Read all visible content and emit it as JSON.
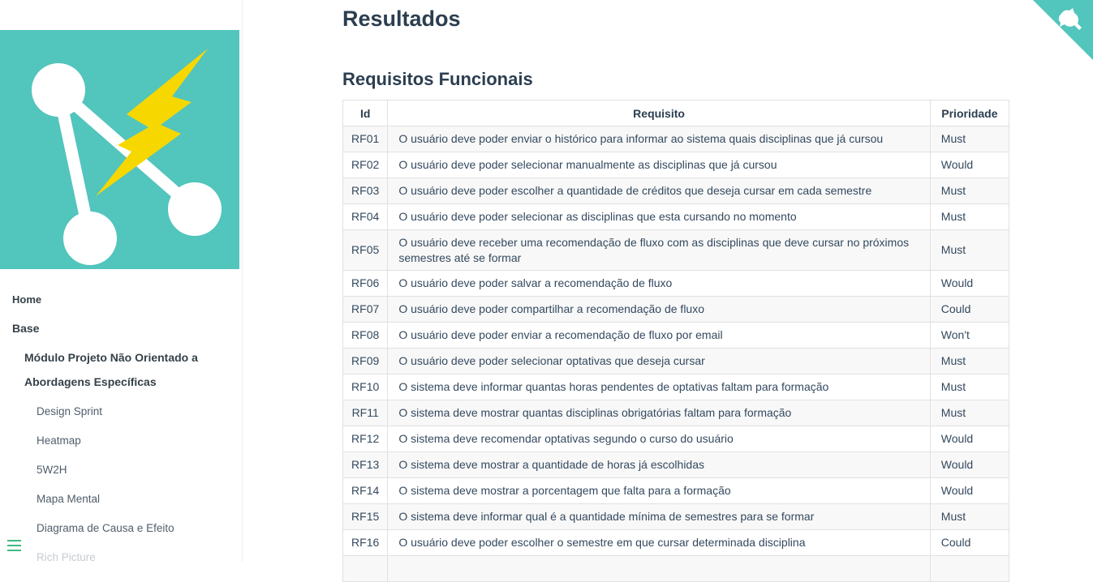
{
  "page": {
    "heading": "Resultados",
    "section_heading": "Requisitos Funcionais"
  },
  "colors": {
    "accent": "#42b983",
    "logo_bg": "#52c5bd",
    "bolt": "#f7d700"
  },
  "sidebar": {
    "items": [
      {
        "label": "Home"
      },
      {
        "label": "Base"
      },
      {
        "label": "Módulo Projeto Não Orientado a"
      },
      {
        "label": "Abordagens Específicas"
      },
      {
        "label": "Design Sprint"
      },
      {
        "label": "Heatmap"
      },
      {
        "label": "5W2H"
      },
      {
        "label": "Mapa Mental"
      },
      {
        "label": "Diagrama de Causa e Efeito"
      },
      {
        "label": "Rich Picture"
      }
    ]
  },
  "icons": {
    "menu": "hamburger-icon",
    "corner": "github-octocat-icon"
  },
  "table": {
    "headers": [
      "Id",
      "Requisito",
      "Prioridade"
    ],
    "rows": [
      {
        "id": "RF01",
        "text": "O usuário deve poder enviar o histórico para informar ao sistema quais disciplinas que já cursou",
        "priority": "Must"
      },
      {
        "id": "RF02",
        "text": "O usuário deve poder selecionar manualmente as disciplinas que já cursou",
        "priority": "Would"
      },
      {
        "id": "RF03",
        "text": "O usuário deve poder escolher a quantidade de créditos que deseja cursar em cada semestre",
        "priority": "Must"
      },
      {
        "id": "RF04",
        "text": "O usuário deve poder selecionar as disciplinas que esta cursando no momento",
        "priority": "Must"
      },
      {
        "id": "RF05",
        "text": "O usuário deve receber uma recomendação de fluxo com as disciplinas que deve cursar no próximos semestres até se formar",
        "priority": "Must"
      },
      {
        "id": "RF06",
        "text": "O usuário deve poder salvar a recomendação de fluxo",
        "priority": "Would"
      },
      {
        "id": "RF07",
        "text": "O usuário deve poder compartilhar a recomendação de fluxo",
        "priority": "Could"
      },
      {
        "id": "RF08",
        "text": "O usuário deve poder enviar a recomendação de fluxo por email",
        "priority": "Won't"
      },
      {
        "id": "RF09",
        "text": "O usuário deve poder selecionar optativas que deseja cursar",
        "priority": "Must"
      },
      {
        "id": "RF10",
        "text": "O sistema deve informar quantas horas pendentes de optativas faltam para formação",
        "priority": "Must"
      },
      {
        "id": "RF11",
        "text": "O sistema deve mostrar quantas disciplinas obrigatórias faltam para formação",
        "priority": "Must"
      },
      {
        "id": "RF12",
        "text": "O sistema deve recomendar optativas segundo o curso do usuário",
        "priority": "Would"
      },
      {
        "id": "RF13",
        "text": "O sistema deve mostrar a quantidade de horas já escolhidas",
        "priority": "Would"
      },
      {
        "id": "RF14",
        "text": "O sistema deve mostrar a porcentagem que falta para a formação",
        "priority": "Would"
      },
      {
        "id": "RF15",
        "text": "O sistema deve informar qual é a quantidade mínima de semestres para se formar",
        "priority": "Must"
      },
      {
        "id": "RF16",
        "text": "O usuário deve poder escolher o semestre em que cursar determinada disciplina",
        "priority": "Could"
      }
    ]
  }
}
